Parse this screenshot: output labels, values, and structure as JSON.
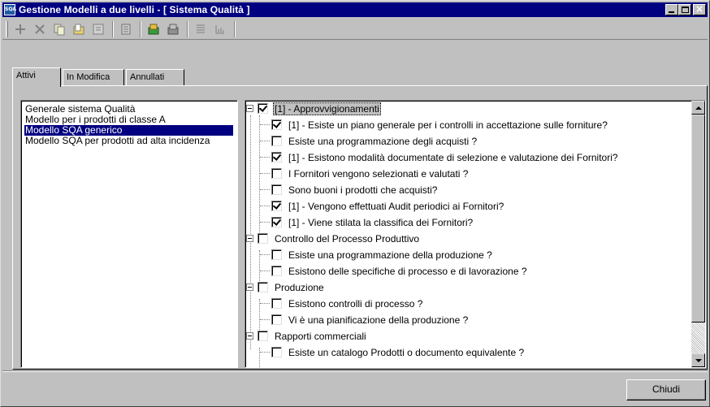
{
  "window": {
    "title": "Gestione Modelli a due livelli - [ Sistema Qualità ]",
    "app_icon": "SQA",
    "buttons": [
      "minimize",
      "maximize",
      "close"
    ]
  },
  "toolbar": {
    "icons": [
      "add-icon",
      "delete-icon",
      "copy-icon",
      "edit-folder-icon",
      "properties-icon",
      "stamp-icon",
      "import-icon",
      "export-icon",
      "tree-list-icon",
      "chart-icon"
    ]
  },
  "tabs": [
    {
      "label": "Attivi",
      "active": true
    },
    {
      "label": "In Modifica",
      "active": false
    },
    {
      "label": "Annullati",
      "active": false
    }
  ],
  "models": [
    {
      "label": "Generale sistema Qualità",
      "selected": false
    },
    {
      "label": "Modello per i prodotti di classe A",
      "selected": false
    },
    {
      "label": "Modello SQA generico",
      "selected": true
    },
    {
      "label": "Modello SQA per prodotti ad alta incidenza",
      "selected": false
    }
  ],
  "tree": [
    {
      "label": "[1] - Approvvigionamenti",
      "checked": true,
      "level": 0,
      "selected": true
    },
    {
      "label": "[1] - Esiste un piano generale per i controlli in accettazione sulle forniture?",
      "checked": true,
      "level": 1
    },
    {
      "label": "Esiste una programmazione degli acquisti ?",
      "checked": false,
      "level": 1
    },
    {
      "label": "[1] - Esistono modalità documentate di selezione e valutazione dei Fornitori?",
      "checked": true,
      "level": 1
    },
    {
      "label": "I Fornitori vengono selezionati e valutati ?",
      "checked": false,
      "level": 1
    },
    {
      "label": "Sono buoni i prodotti che acquisti?",
      "checked": false,
      "level": 1
    },
    {
      "label": "[1] - Vengono effettuati Audit periodici ai Fornitori?",
      "checked": true,
      "level": 1
    },
    {
      "label": "[1] - Viene stilata la classifica dei Fornitori?",
      "checked": true,
      "level": 1
    },
    {
      "label": "Controllo del Processo Produttivo",
      "checked": false,
      "level": 0
    },
    {
      "label": "Esiste una programmazione della produzione ?",
      "checked": false,
      "level": 1
    },
    {
      "label": "Esistono delle specifiche di processo e di lavorazione ?",
      "checked": false,
      "level": 1
    },
    {
      "label": "Produzione",
      "checked": false,
      "level": 0
    },
    {
      "label": "Esistono controlli di processo ?",
      "checked": false,
      "level": 1
    },
    {
      "label": "Vi è una pianificazione della produzione ?",
      "checked": false,
      "level": 1
    },
    {
      "label": "Rapporti commerciali",
      "checked": false,
      "level": 0
    },
    {
      "label": "Esiste un catalogo Prodotti o documento equivalente ?",
      "checked": false,
      "level": 1
    }
  ],
  "footer": {
    "close_label": "Chiudi"
  }
}
